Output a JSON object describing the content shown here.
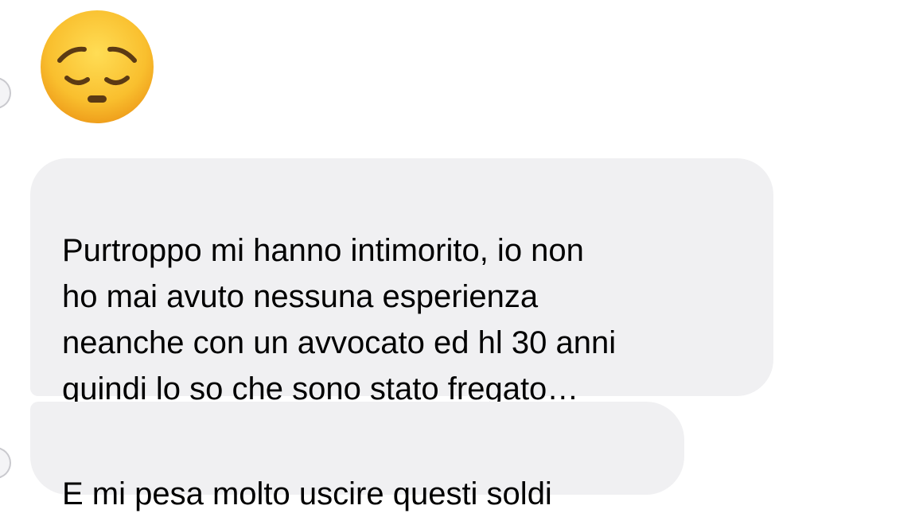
{
  "conversation": {
    "reaction_emoji": "pensive-face-icon",
    "messages": [
      {
        "text": "Purtroppo mi hanno intimorito, io non\nho mai avuto nessuna esperienza\nneanche con un avvocato ed hl 30 anni\nquindi lo so che sono stato fregato…"
      },
      {
        "text": "E mi pesa molto uscire questi soldi"
      }
    ]
  },
  "colors": {
    "bubble_background": "#f0f0f2",
    "text": "#000000",
    "emoji_face": "#f7b52c"
  }
}
